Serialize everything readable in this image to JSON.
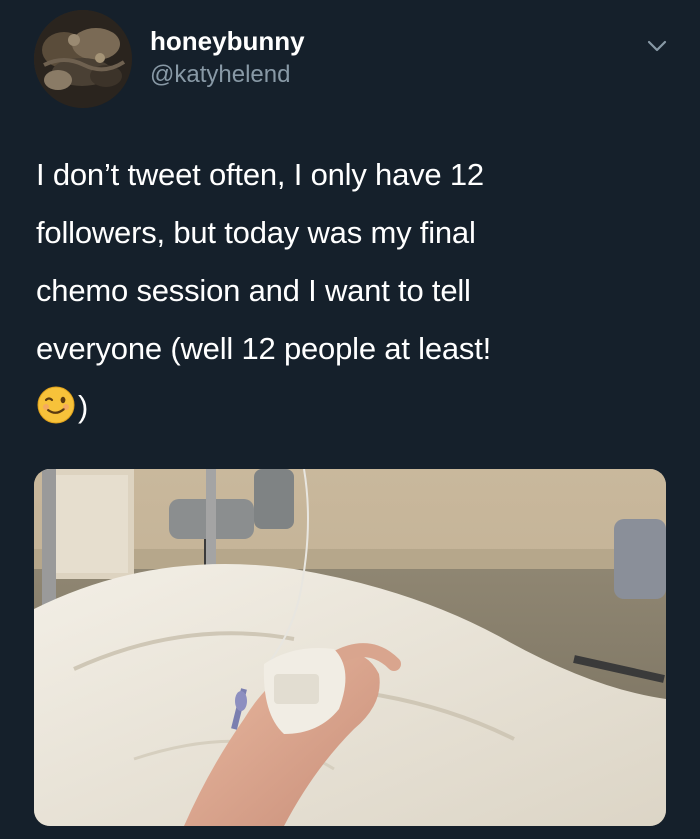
{
  "tweet": {
    "author": {
      "display_name": "honeybunny",
      "handle": "@katyhelend"
    },
    "text_lines": [
      "I don’t tweet often, I only have 12",
      "followers, but today was my final",
      "chemo session and I want to tell",
      "everyone (well 12 people at least!"
    ],
    "text_end": ")",
    "emoji": "winking-face-emoji",
    "caret_icon": "chevron-down-icon",
    "media_icon": "photo-hospital-hand-iv"
  }
}
